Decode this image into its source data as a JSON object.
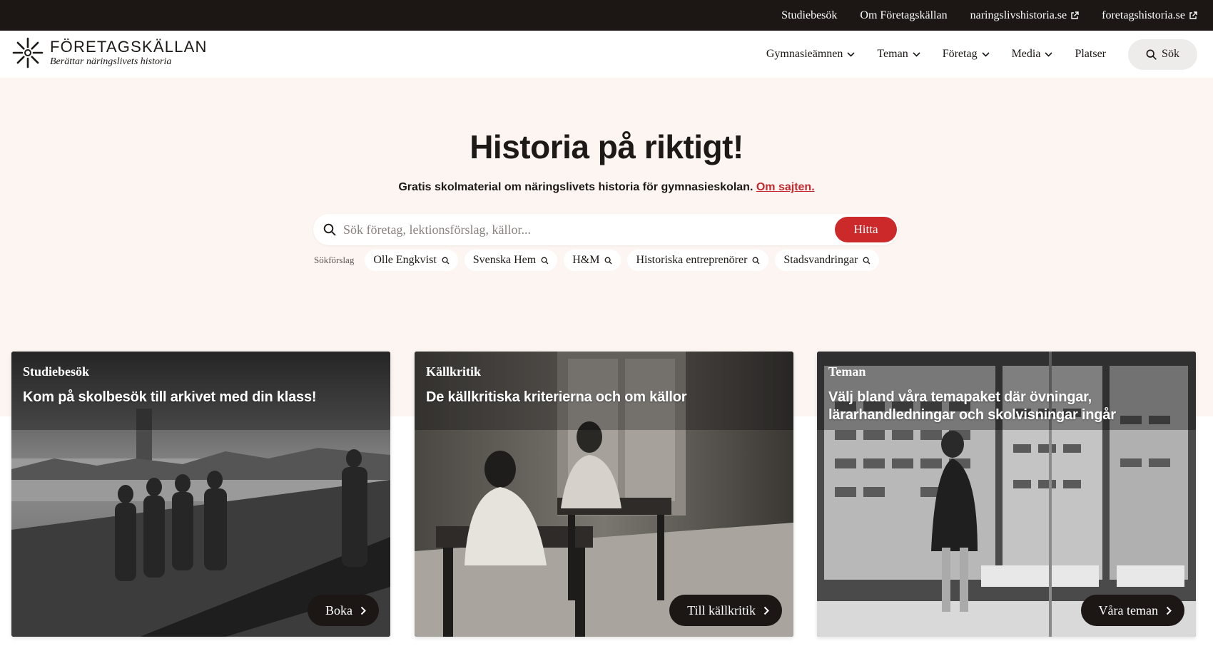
{
  "topbar": {
    "links": [
      {
        "label": "Studiebesök",
        "external": false
      },
      {
        "label": "Om Företagskällan",
        "external": false
      },
      {
        "label": "naringslivshistoria.se",
        "external": true
      },
      {
        "label": "foretagshistoria.se",
        "external": true
      }
    ]
  },
  "header": {
    "logo_name": "FÖRETAGSKÄLLAN",
    "logo_tagline": "Berättar näringslivets historia",
    "nav": [
      {
        "label": "Gymnasieämnen",
        "dropdown": true
      },
      {
        "label": "Teman",
        "dropdown": true
      },
      {
        "label": "Företag",
        "dropdown": true
      },
      {
        "label": "Media",
        "dropdown": true
      },
      {
        "label": "Platser",
        "dropdown": false
      }
    ],
    "search_label": "Sök"
  },
  "hero": {
    "title": "Historia på riktigt!",
    "subtitle": "Gratis skolmaterial om näringslivets historia för gymnasieskolan.",
    "about_link": "Om sajten.",
    "search_placeholder": "Sök företag, lektionsförslag, källor...",
    "search_value": "",
    "search_button": "Hitta",
    "suggestions_label": "Sökförslag",
    "suggestions": [
      "Olle Engkvist",
      "Svenska Hem",
      "H&M",
      "Historiska entreprenörer",
      "Stadsvandringar"
    ]
  },
  "cards": [
    {
      "label": "Studiebesök",
      "title": "Kom på skolbesök till arkivet med din klass!",
      "button": "Boka"
    },
    {
      "label": "Källkritik",
      "title": "De källkritiska kriterierna och om källor",
      "button": "Till källkritik"
    },
    {
      "label": "Teman",
      "title": "Välj bland våra temapaket där övningar, lärarhandledningar och skolvisningar ingår",
      "button": "Våra teman"
    }
  ],
  "colors": {
    "topbar_bg": "#1c1715",
    "hero_bg": "#fcf5f1",
    "accent_red": "#cc2a2a",
    "link_red": "#c6282e",
    "text_dark": "#1d1917"
  },
  "icons": {
    "external": "external-link-icon",
    "chevron": "chevron-down-icon",
    "search": "search-icon",
    "arrow": "chevron-right-icon"
  }
}
